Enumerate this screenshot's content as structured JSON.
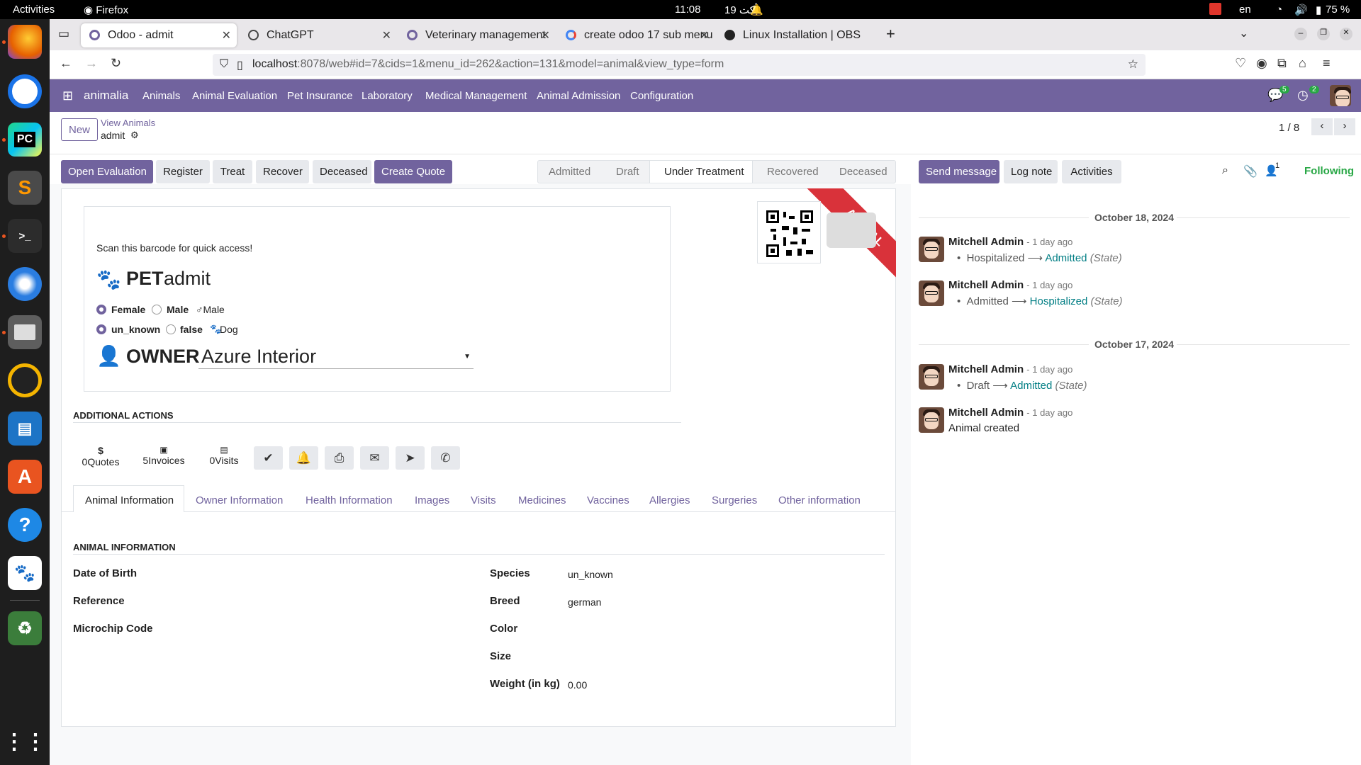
{
  "topbar": {
    "activities": "Activities",
    "app": "Firefox",
    "clock": "11:08",
    "date": "19 أكت",
    "lang": "en",
    "battery": "75 %"
  },
  "browser": {
    "tabs": [
      {
        "label": "Odoo - admit",
        "active": true
      },
      {
        "label": "ChatGPT"
      },
      {
        "label": "Veterinary management"
      },
      {
        "label": "create odoo 17 sub menu"
      },
      {
        "label": "Linux Installation | OBS"
      }
    ],
    "url_host": "localhost",
    "url_rest": ":8078/web#id=7&cids=1&menu_id=262&action=131&model=animal&view_type=form"
  },
  "odoo_nav": {
    "brand": "animalia",
    "menu": [
      "Animals",
      "Animal Evaluation",
      "Pet Insurance",
      "Laboratory",
      "Medical Management",
      "Animal Admission",
      "Configuration"
    ],
    "msg_count": "5",
    "activity_count": "2"
  },
  "control": {
    "new": "New",
    "breadcrumb_parent": "View Animals",
    "breadcrumb_current": "admit",
    "pager": "1 / 8"
  },
  "actions": {
    "buttons": [
      "Open Evaluation",
      "Register",
      "Treat",
      "Recover",
      "Deceased",
      "Create Quote"
    ],
    "stages": [
      "Admitted",
      "Draft",
      "Under Treatment",
      "Recovered",
      "Deceased"
    ],
    "current_stage": "Under Treatment"
  },
  "form": {
    "scan_text": "Scan this barcode for quick access!",
    "pet_label": "PET",
    "pet_name": "admit",
    "gender_options": [
      "Female",
      "Male"
    ],
    "gender_selected": "Female",
    "gender_display": "♂Male",
    "type_options": [
      "un_known",
      "false"
    ],
    "type_selected": "un_known",
    "type_display": "Dog",
    "owner_label": "OWNER",
    "owner_value": "Azure Interior",
    "ribbon": "ANIMAL",
    "additional_actions": "ADDITIONAL ACTIONS",
    "stats": [
      {
        "icon": "$",
        "value": "0",
        "label": "Quotes"
      },
      {
        "icon": "▣",
        "value": "5",
        "label": "Invoices"
      },
      {
        "icon": "▤",
        "value": "0",
        "label": "Visits"
      }
    ],
    "tabs": [
      "Animal Information",
      "Owner Information",
      "Health Information",
      "Images",
      "Visits",
      "Medicines",
      "Vaccines",
      "Allergies",
      "Surgeries",
      "Other information"
    ],
    "section_title": "ANIMAL INFORMATION",
    "left_fields": [
      {
        "label": "Date of Birth",
        "value": ""
      },
      {
        "label": "Reference",
        "value": ""
      },
      {
        "label": "Microchip Code",
        "value": ""
      }
    ],
    "right_fields": [
      {
        "label": "Species",
        "value": "un_known"
      },
      {
        "label": "Breed",
        "value": "german"
      },
      {
        "label": "Color",
        "value": ""
      },
      {
        "label": "Size",
        "value": ""
      },
      {
        "label": "Weight (in kg)",
        "value": "0.00"
      }
    ]
  },
  "chatter": {
    "send_message": "Send message",
    "log_note": "Log note",
    "activities": "Activities",
    "followers": "1",
    "following": "Following",
    "groups": [
      {
        "date": "October 18, 2024",
        "messages": [
          {
            "author": "Mitchell Admin",
            "time": "- 1 day ago",
            "from": "Hospitalized",
            "to": "Admitted",
            "field": "(State)"
          },
          {
            "author": "Mitchell Admin",
            "time": "- 1 day ago",
            "from": "Admitted",
            "to": "Hospitalized",
            "field": "(State)"
          }
        ]
      },
      {
        "date": "October 17, 2024",
        "messages": [
          {
            "author": "Mitchell Admin",
            "time": "- 1 day ago",
            "from": "Draft",
            "to": "Admitted",
            "field": "(State)"
          },
          {
            "author": "Mitchell Admin",
            "time": "- 1 day ago",
            "text": "Animal created"
          }
        ]
      }
    ]
  },
  "colors": {
    "odoo_primary": "#71639e",
    "chatter_link": "#017e84",
    "ribbon": "#d9323a",
    "following": "#28a745"
  }
}
